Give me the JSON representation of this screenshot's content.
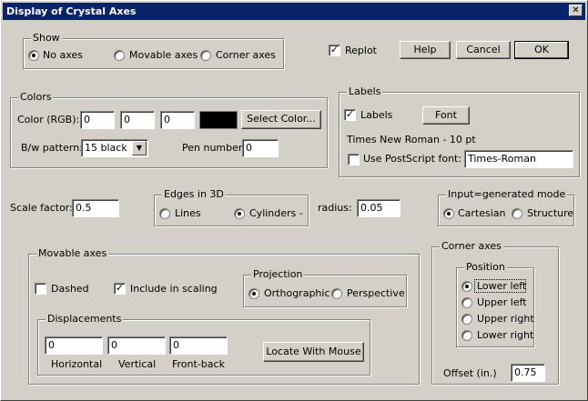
{
  "window": {
    "title": "Display of Crystal Axes",
    "close_icon": "close-icon"
  },
  "show": {
    "legend": "Show",
    "options": [
      "No axes",
      "Movable axes",
      "Corner axes"
    ],
    "selected": "No axes"
  },
  "replot": {
    "label": "Replot",
    "checked": true
  },
  "buttons": {
    "help": "Help",
    "cancel": "Cancel",
    "ok": "OK"
  },
  "colors": {
    "legend": "Colors",
    "rgb_label": "Color (RGB):",
    "r": "0",
    "g": "0",
    "b": "0",
    "swatch_color": "#000000",
    "select_color": "Select  Color...",
    "bw_label": "B/w pattern:",
    "bw_value": "15 black",
    "pen_label": "Pen number:",
    "pen_value": "0"
  },
  "labels": {
    "legend": "Labels",
    "labels_check": "Labels",
    "labels_checked": true,
    "font_button": "Font",
    "font_desc": "Times New Roman - 10 pt",
    "postscript_label": "Use PostScript font:",
    "postscript_checked": false,
    "postscript_value": "Times-Roman"
  },
  "scale": {
    "label": "Scale factor:",
    "value": "0.5"
  },
  "edges": {
    "legend": "Edges in 3D",
    "options": [
      "Lines",
      "Cylinders -"
    ],
    "selected": "Cylinders -"
  },
  "radius": {
    "label": "radius:",
    "value": "0.05"
  },
  "input_mode": {
    "legend": "Input=generated mode",
    "options": [
      "Cartesian",
      "Structure"
    ],
    "selected": "Cartesian"
  },
  "movable": {
    "legend": "Movable axes",
    "dashed": "Dashed",
    "dashed_checked": false,
    "include": "Include in scaling",
    "include_checked": true,
    "projection": {
      "legend": "Projection",
      "options": [
        "Orthographic",
        "Perspective"
      ],
      "selected": "Orthographic"
    },
    "displacements": {
      "legend": "Displacements",
      "h": "0",
      "v": "0",
      "f": "0",
      "h_label": "Horizontal",
      "v_label": "Vertical",
      "f_label": "Front-back",
      "locate": "Locate With Mouse"
    }
  },
  "corner": {
    "legend": "Corner axes",
    "position_legend": "Position",
    "options": [
      "Lower left",
      "Upper left",
      "Upper right",
      "Lower right"
    ],
    "selected": "Lower left",
    "offset_label": "Offset (in.)",
    "offset_value": "0.75"
  }
}
